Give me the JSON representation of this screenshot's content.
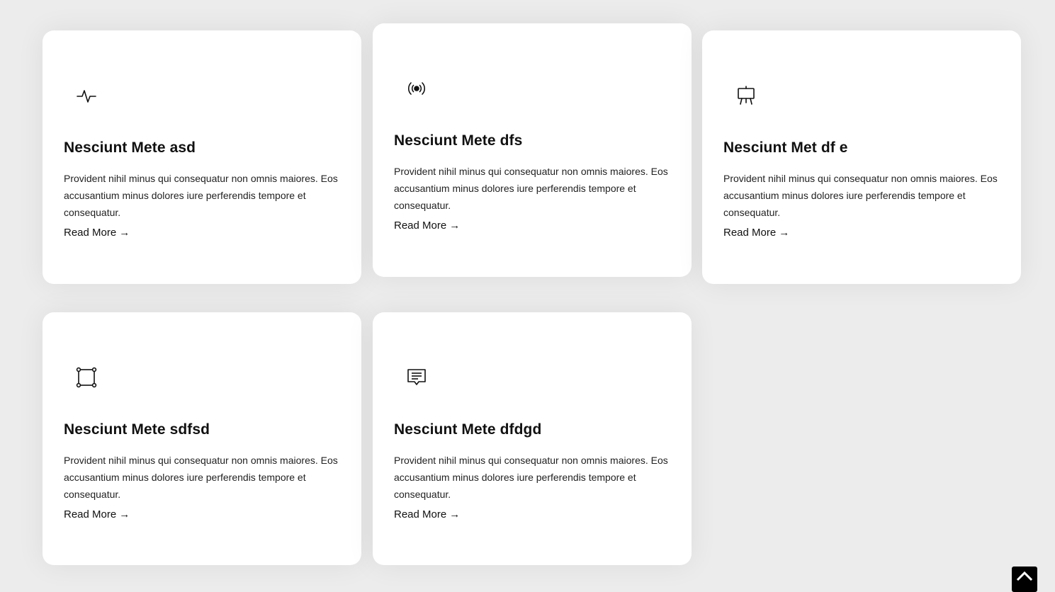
{
  "cards": [
    {
      "icon": "activity-icon",
      "title": "Nesciunt Mete asd",
      "description": "Provident nihil minus qui consequatur non omnis maiores. Eos accusantium minus dolores iure perferendis tempore et consequatur.",
      "link_label": "Read More",
      "link_arrow": "→"
    },
    {
      "icon": "broadcast-icon",
      "title": "Nesciunt Mete dfs",
      "description": "Provident nihil minus qui consequatur non omnis maiores. Eos accusantium minus dolores iure perferendis tempore et consequatur.",
      "link_label": "Read More",
      "link_arrow": "→"
    },
    {
      "icon": "easel-icon",
      "title": "Nesciunt Met df e",
      "description": "Provident nihil minus qui consequatur non omnis maiores. Eos accusantium minus dolores iure perferendis tempore et consequatur.",
      "link_label": "Read More",
      "link_arrow": "→"
    },
    {
      "icon": "bounding-box-icon",
      "title": "Nesciunt Mete sdfsd",
      "description": "Provident nihil minus qui consequatur non omnis maiores. Eos accusantium minus dolores iure perferendis tempore et consequatur.",
      "link_label": "Read More",
      "link_arrow": "→"
    },
    {
      "icon": "chat-text-icon",
      "title": "Nesciunt Mete dfdgd",
      "description": "Provident nihil minus qui consequatur non omnis maiores. Eos accusantium minus dolores iure perferendis tempore et consequatur.",
      "link_label": "Read More",
      "link_arrow": "→"
    }
  ],
  "scroll_top": {
    "icon": "chevron-up-icon"
  },
  "colors": {
    "background": "#ececec",
    "card": "#ffffff",
    "text": "#111111",
    "scroll_top_bg": "#000000"
  }
}
